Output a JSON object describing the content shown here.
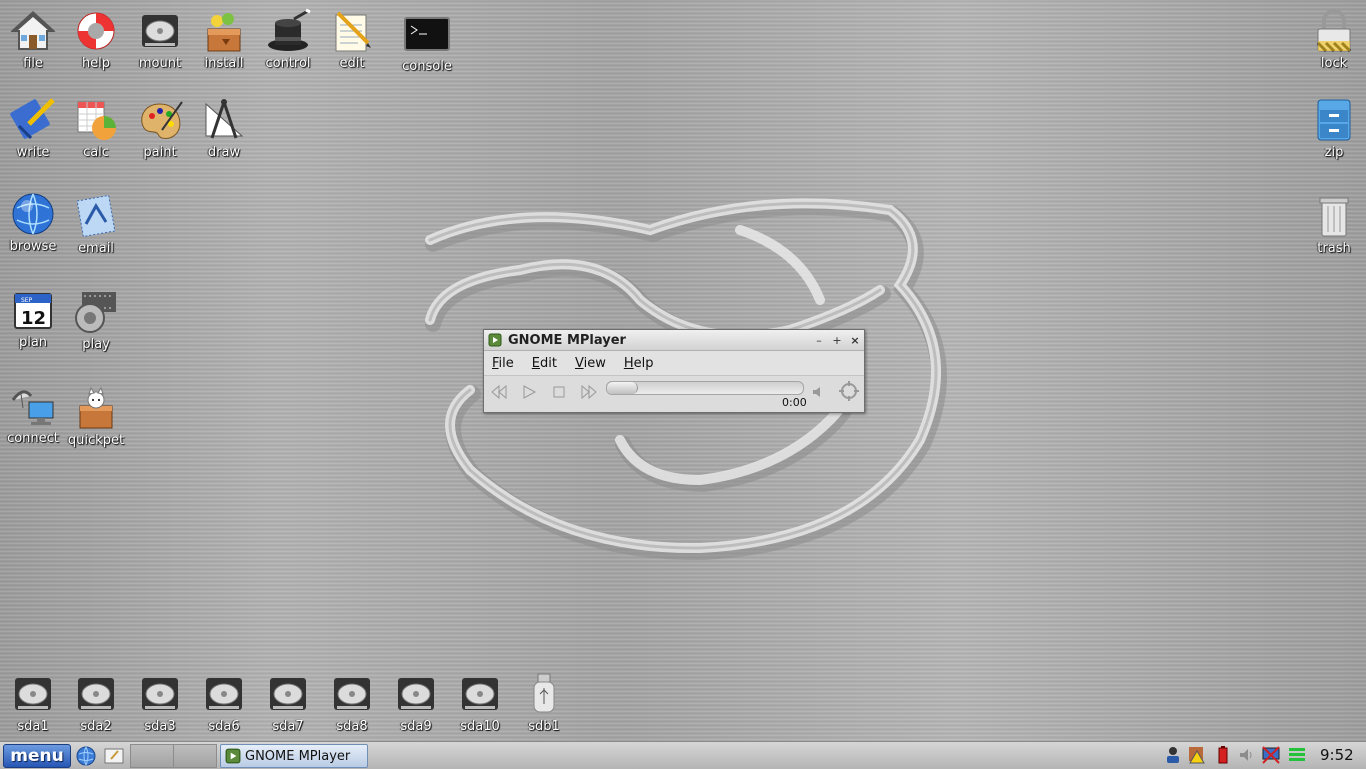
{
  "desktop": {
    "left_icons": [
      {
        "label": "file",
        "icon": "house-icon"
      },
      {
        "label": "help",
        "icon": "lifebuoy-icon"
      },
      {
        "label": "mount",
        "icon": "harddrive-icon"
      },
      {
        "label": "install",
        "icon": "package-box-icon"
      },
      {
        "label": "control",
        "icon": "magic-hat-icon"
      },
      {
        "label": "edit",
        "icon": "notepad-pencil-icon"
      },
      {
        "label": "console",
        "icon": "terminal-icon"
      },
      {
        "label": "write",
        "icon": "writer-icon"
      },
      {
        "label": "calc",
        "icon": "spreadsheet-icon"
      },
      {
        "label": "paint",
        "icon": "palette-icon"
      },
      {
        "label": "draw",
        "icon": "compass-ruler-icon"
      },
      {
        "label": "browse",
        "icon": "globe-icon"
      },
      {
        "label": "email",
        "icon": "email-stamp-icon"
      },
      {
        "label": "plan",
        "icon": "calendar-icon"
      },
      {
        "label": "play",
        "icon": "speaker-film-icon"
      },
      {
        "label": "connect",
        "icon": "network-satellite-icon"
      },
      {
        "label": "quickpet",
        "icon": "pet-box-icon"
      }
    ],
    "calendar_month": "SEP",
    "calendar_day": "12",
    "right_icons": [
      {
        "label": "lock",
        "icon": "padlock-icon"
      },
      {
        "label": "zip",
        "icon": "archive-cabinet-icon"
      },
      {
        "label": "trash",
        "icon": "trash-can-icon"
      }
    ],
    "drives": [
      "sda1",
      "sda2",
      "sda3",
      "sda6",
      "sda7",
      "sda8",
      "sda9",
      "sda10",
      "sdb1"
    ]
  },
  "window": {
    "title": "GNOME MPlayer",
    "menus": [
      "File",
      "Edit",
      "View",
      "Help"
    ],
    "time": "0:00",
    "progress": 0
  },
  "taskbar": {
    "menu_label": "menu",
    "task_label": "GNOME MPlayer",
    "clock": "9:52"
  },
  "colors": {
    "menu_button": "#2656b4",
    "task_button": "#b9cbe4"
  }
}
